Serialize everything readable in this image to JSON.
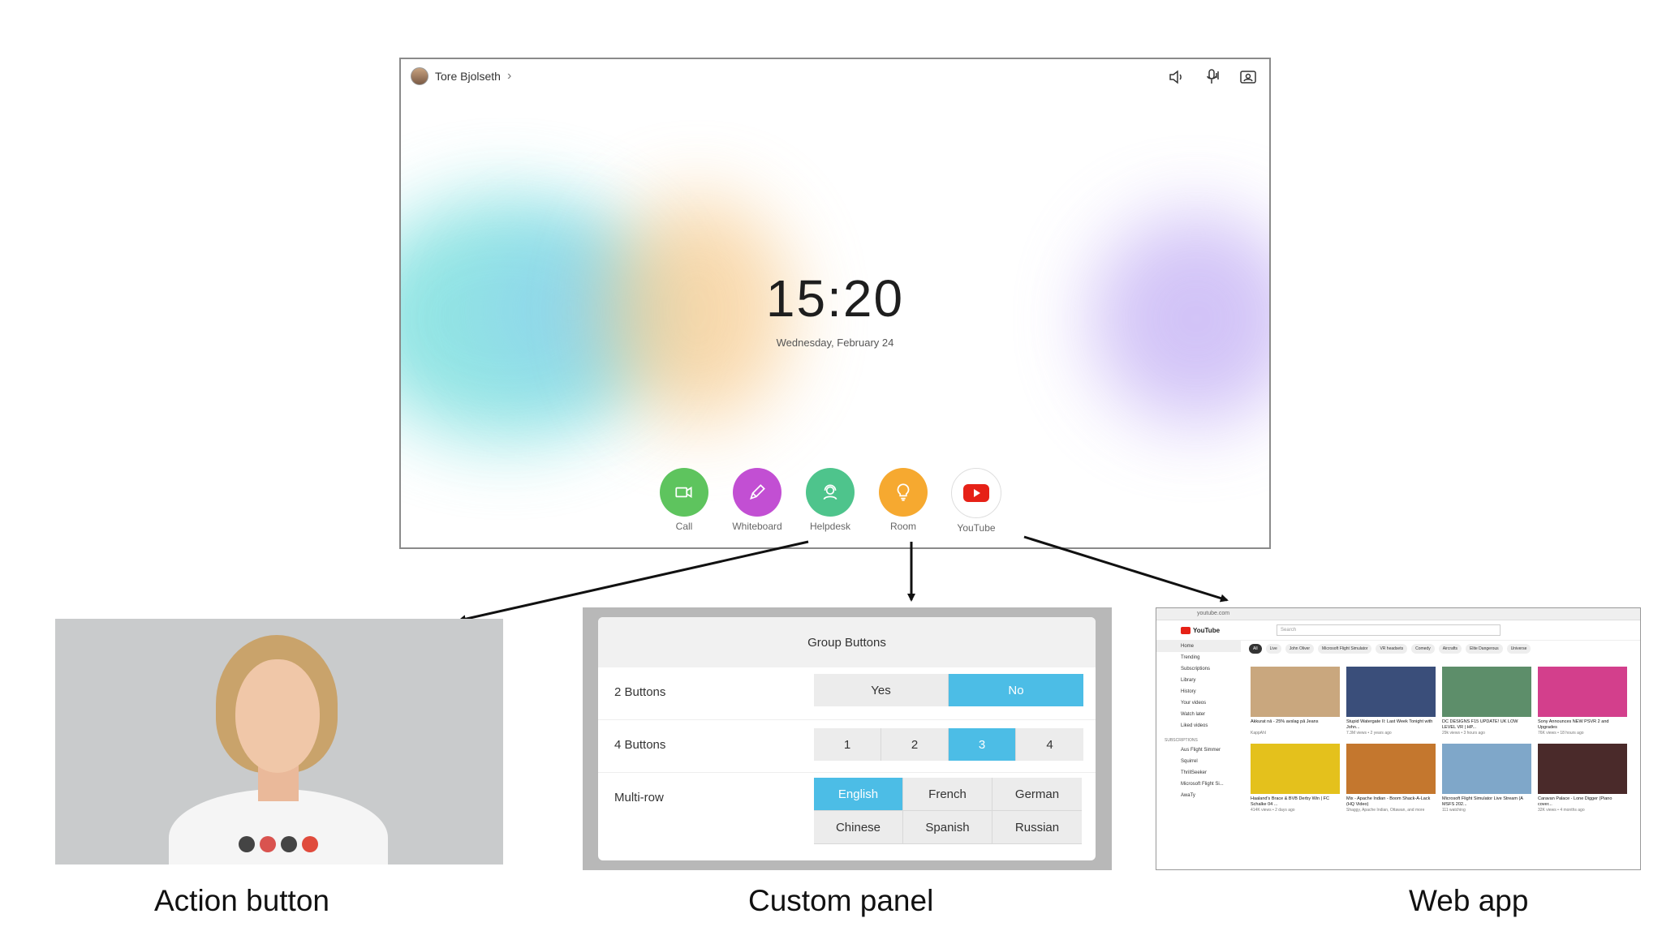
{
  "screen": {
    "user_name": "Tore Bjolseth",
    "time": "15:20",
    "date": "Wednesday, February 24",
    "apps": [
      {
        "label": "Call",
        "icon": "camera-icon"
      },
      {
        "label": "Whiteboard",
        "icon": "pencil-icon"
      },
      {
        "label": "Helpdesk",
        "icon": "person-headset-icon"
      },
      {
        "label": "Room",
        "icon": "lightbulb-icon"
      },
      {
        "label": "YouTube",
        "icon": "youtube-icon"
      }
    ]
  },
  "custom_panel": {
    "title": "Group Buttons",
    "rows": [
      {
        "label": "2 Buttons",
        "buttons": [
          "Yes",
          "No"
        ],
        "selected": "No"
      },
      {
        "label": "4 Buttons",
        "buttons": [
          "1",
          "2",
          "3",
          "4"
        ],
        "selected": "3"
      },
      {
        "label": "Multi-row",
        "buttons": [
          "English",
          "French",
          "German",
          "Chinese",
          "Spanish",
          "Russian"
        ],
        "selected": "English"
      }
    ]
  },
  "web_app": {
    "url": "youtube.com",
    "search_placeholder": "Search",
    "sidebar": [
      "Home",
      "Trending",
      "Subscriptions",
      "Library",
      "History",
      "Your videos",
      "Watch later",
      "Liked videos"
    ],
    "subscriptions_heading": "SUBSCRIPTIONS",
    "subscriptions": [
      "Aus Flight Simmer",
      "Squirrel",
      "ThrillSeeker",
      "Microsoft Flight Si...",
      "AwaTy"
    ],
    "chips": [
      "All",
      "Live",
      "John Oliver",
      "Microsoft Flight Simulator",
      "VR headsets",
      "Comedy",
      "Aircrafts",
      "Elite Dangerous",
      "Universe"
    ],
    "videos": [
      {
        "title": "Akkurat nå - 25% avslag på Jeans",
        "meta": "KappAhl",
        "color": "#c9a77e"
      },
      {
        "title": "Stupid Watergate II: Last Week Tonight with John...",
        "meta": "7.3M views • 2 years ago",
        "color": "#3a4e7a"
      },
      {
        "title": "DC DESIGNS F15 UPDATE! UK LOW LEVEL VR | HP...",
        "meta": "29k views • 3 hours ago",
        "color": "#5d8e6a"
      },
      {
        "title": "Sony Announces NEW PSVR 2 and Upgrades",
        "meta": "76K views • 18 hours ago",
        "color": "#d33f8c"
      },
      {
        "title": "Haaland's Brace & BVB Derby Win | FC Schalke 04 ...",
        "meta": "414K views • 2 days ago",
        "color": "#e4c11c"
      },
      {
        "title": "Mix - Apache Indian - Boom Shack-A-Lack (HQ Video)",
        "meta": "Shaggy, Apache Indian, Ottawan, and more",
        "color": "#c4772e"
      },
      {
        "title": "Microsoft Flight Simulator Live Stream (A MSFS 202...",
        "meta": "111 watching",
        "color": "#7fa7c9"
      },
      {
        "title": "Caravan Palace - Lone Digger (Piano cover...",
        "meta": "32K views • 4 months ago",
        "color": "#4a2a2a"
      }
    ]
  },
  "captions": {
    "action": "Action button",
    "panel": "Custom panel",
    "web": "Web app"
  }
}
